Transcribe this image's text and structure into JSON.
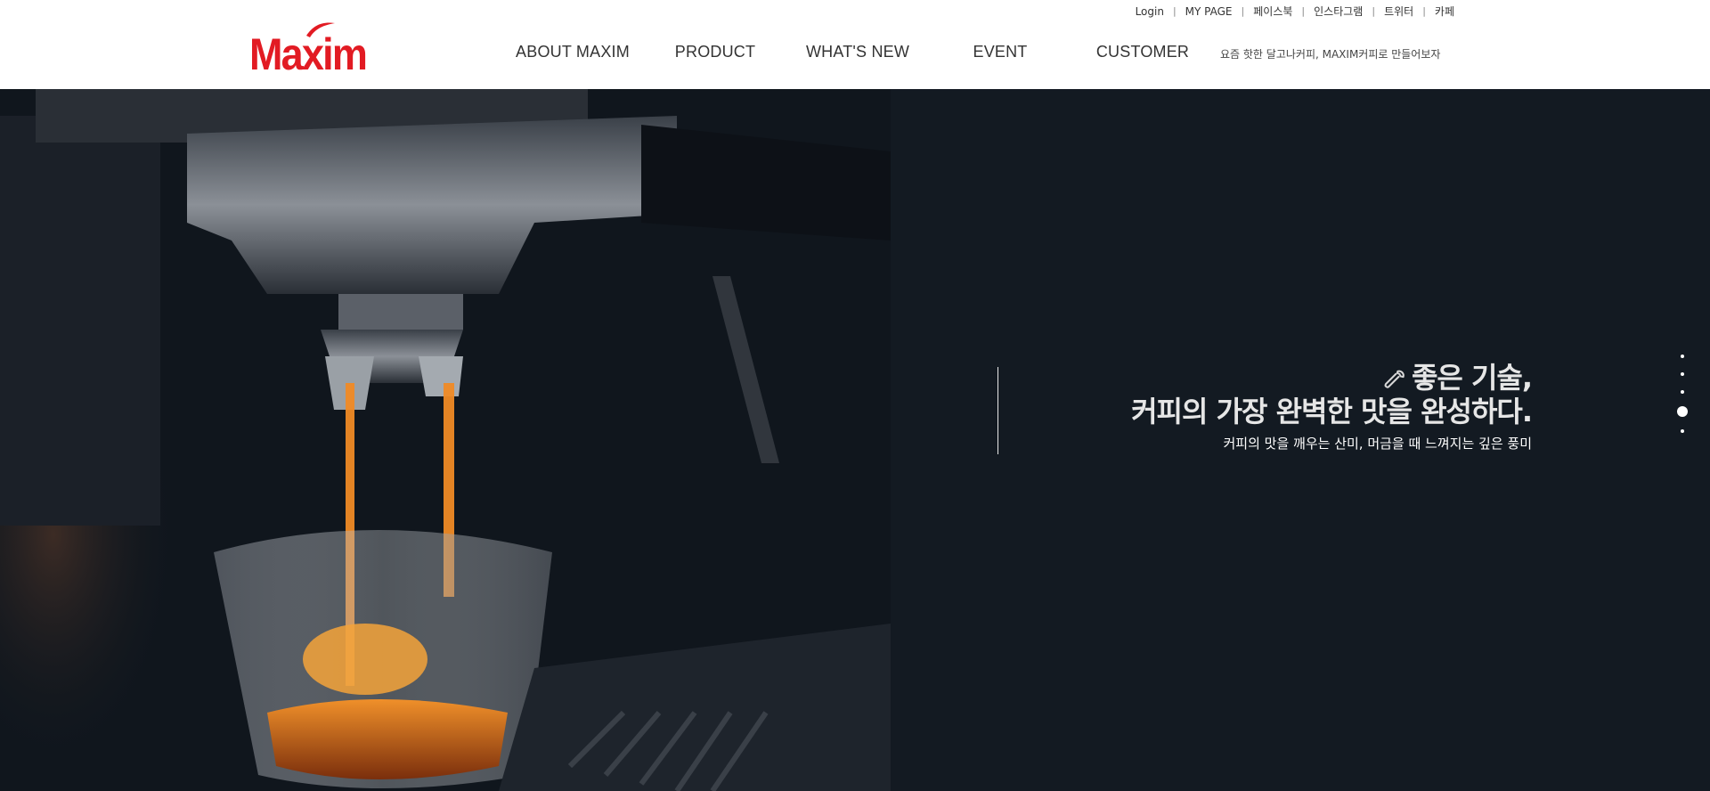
{
  "brand": {
    "logo_text": "Maxim",
    "color": "#e21b23"
  },
  "util_links": [
    "Login",
    "MY PAGE",
    "페이스북",
    "인스타그램",
    "트위터",
    "카페"
  ],
  "util_separator": "|",
  "nav": {
    "items": [
      "ABOUT MAXIM",
      "PRODUCT",
      "WHAT'S NEW",
      "EVENT",
      "CUSTOMER"
    ],
    "tagline": "요즘 핫한 달고나커피, MAXIM커피로 만들어보자"
  },
  "hero": {
    "title_line1": "좋은 기술,",
    "title_line2": "커피의 가장 완벽한 맛을 완성하다.",
    "subtitle": "커피의 맛을 깨우는 산미, 머금을 때 느껴지는 깊은 풍미",
    "icon": "wrench-icon",
    "slide_count": 5,
    "active_slide": 4
  }
}
